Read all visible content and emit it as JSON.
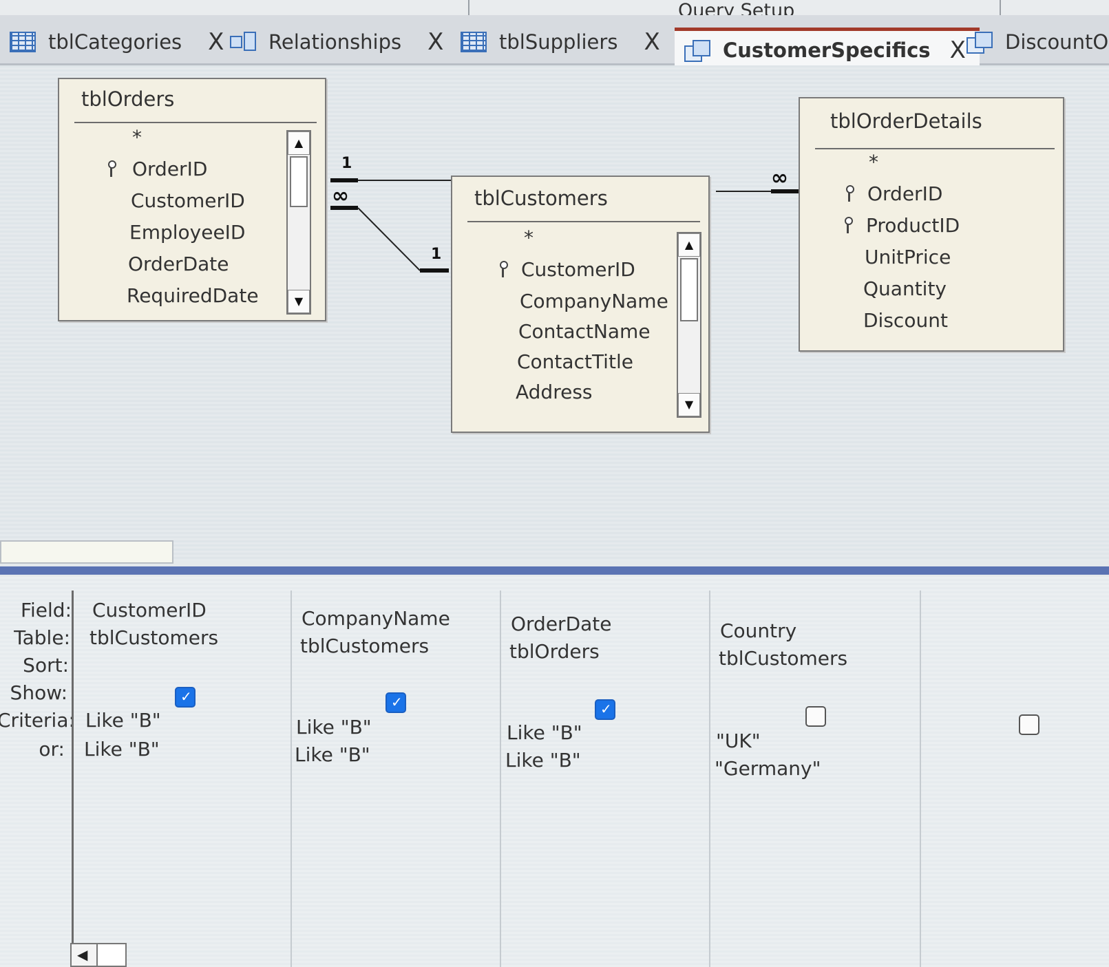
{
  "ribbon": {
    "group_label": "Query Setup"
  },
  "tabs": [
    {
      "label": "tblCategories",
      "icon": "table-icon",
      "active": false
    },
    {
      "label": "Relationships",
      "icon": "relationships-icon",
      "active": false
    },
    {
      "label": "tblSuppliers",
      "icon": "table-icon",
      "active": false
    },
    {
      "label": "CustomerSpecifics",
      "icon": "query-icon",
      "active": true
    },
    {
      "label": "DiscountOr",
      "icon": "query-icon",
      "active": false
    }
  ],
  "close_glyph": "X",
  "tables": {
    "orders": {
      "title": "tblOrders",
      "fields": [
        "*",
        "OrderID",
        "CustomerID",
        "EmployeeID",
        "OrderDate",
        "RequiredDate"
      ]
    },
    "customers": {
      "title": "tblCustomers",
      "fields": [
        "*",
        "CustomerID",
        "CompanyName",
        "ContactName",
        "ContactTitle",
        "Address"
      ]
    },
    "order_details": {
      "title": "tblOrderDetails",
      "fields": [
        "*",
        "OrderID",
        "ProductID",
        "UnitPrice",
        "Quantity",
        "Discount"
      ]
    }
  },
  "relationship_labels": {
    "one": "1",
    "many": "∞"
  },
  "grid": {
    "row_labels": [
      "Field:",
      "Table:",
      "Sort:",
      "Show:",
      "Criteria:",
      "or:"
    ],
    "columns": [
      {
        "field": "CustomerID",
        "table": "tblCustomers",
        "show": true,
        "criteria": "Like \"B\"",
        "or": "Like \"B\""
      },
      {
        "field": "CompanyName",
        "table": "tblCustomers",
        "show": true,
        "criteria": "Like \"B\"",
        "or": "Like \"B\""
      },
      {
        "field": "OrderDate",
        "table": "tblOrders",
        "show": true,
        "criteria": "Like \"B\"",
        "or": "Like \"B\""
      },
      {
        "field": "Country",
        "table": "tblCustomers",
        "show": false,
        "criteria": "\"UK\"",
        "or": "\"Germany\""
      },
      {
        "field": "",
        "table": "",
        "show": false,
        "criteria": "",
        "or": ""
      }
    ]
  },
  "colors": {
    "accent": "#a23a2a",
    "checkbox_on": "#1a73e8",
    "splitter": "#5a73b3"
  }
}
